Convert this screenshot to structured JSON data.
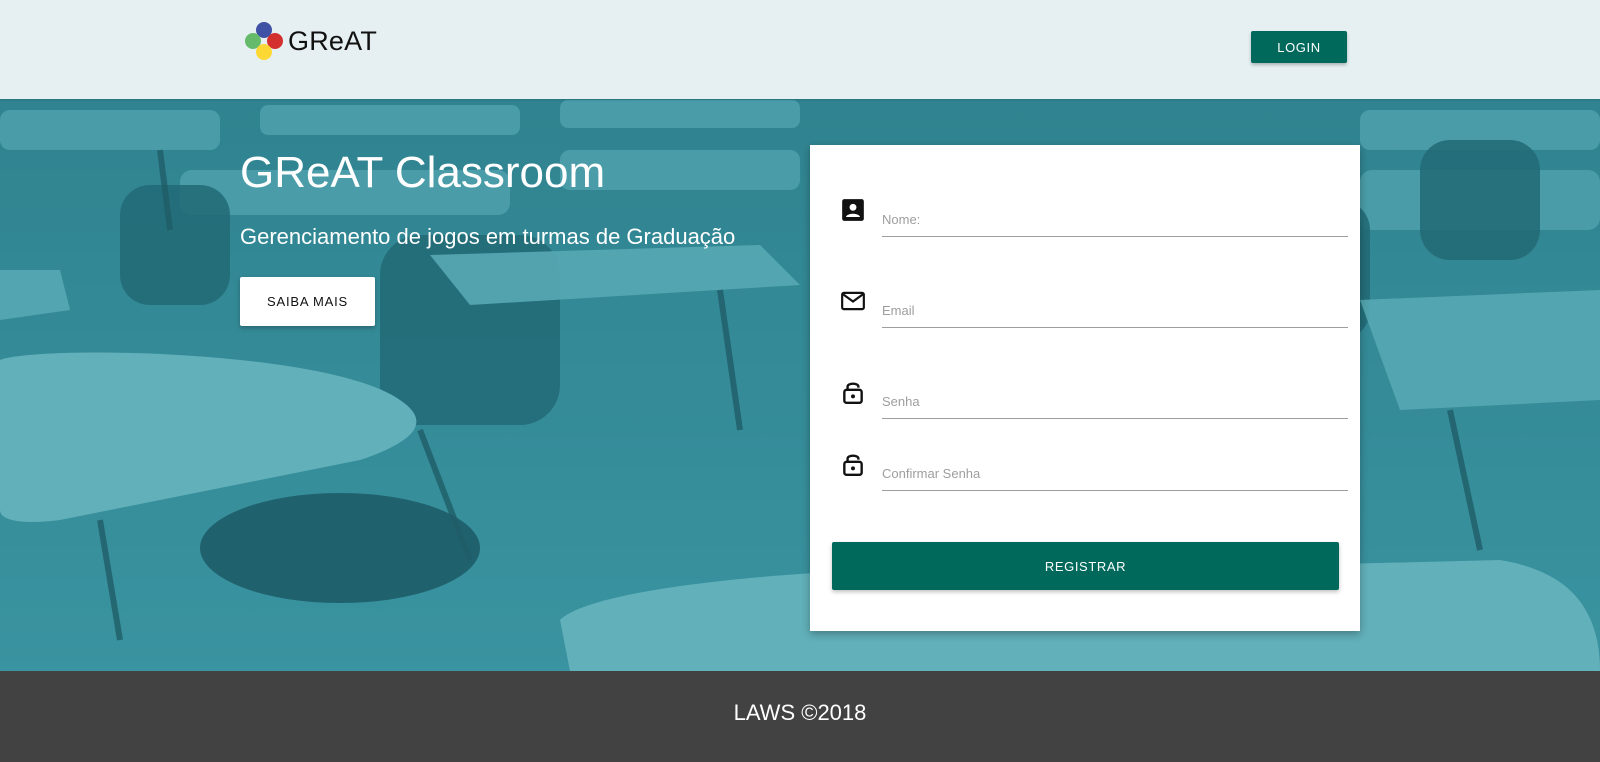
{
  "navbar": {
    "brand": "GReAT",
    "login_label": "LOGIN"
  },
  "hero": {
    "title": "GReAT Classroom",
    "subtitle": "Gerenciamento de jogos em turmas de Graduação",
    "more_label": "SAIBA MAIS"
  },
  "register_form": {
    "fields": [
      {
        "icon": "contact-card-icon",
        "placeholder": "Nome:",
        "value": ""
      },
      {
        "icon": "mail-icon",
        "placeholder": "Email",
        "value": ""
      },
      {
        "icon": "lock-icon",
        "placeholder": "Senha",
        "value": ""
      },
      {
        "icon": "lock-icon",
        "placeholder": "Confirmar Senha",
        "value": ""
      }
    ],
    "submit_label": "REGISTRAR"
  },
  "footer": {
    "text": "LAWS ©2018"
  },
  "colors": {
    "primary": "#00695c",
    "hero_tint": "#3d8f9c",
    "footer_bg": "#424242",
    "logo_blue": "#3f51a5",
    "logo_red": "#d32f2f",
    "logo_green": "#66bb6a",
    "logo_yellow": "#fdd835"
  }
}
